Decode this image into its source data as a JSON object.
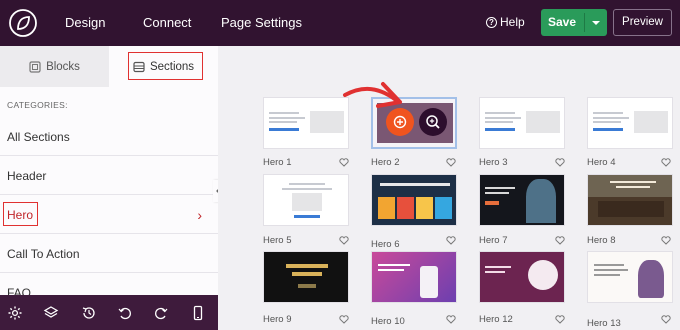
{
  "topbar": {
    "nav": [
      "Design",
      "Connect",
      "Page Settings"
    ],
    "help": "Help",
    "help_icon": "question-circle-icon",
    "save": "Save",
    "preview": "Preview"
  },
  "sidebar": {
    "tabs": {
      "blocks": "Blocks",
      "sections": "Sections",
      "active": "Sections"
    },
    "categories_title": "CATEGORIES:",
    "categories": [
      "All Sections",
      "Header",
      "Hero",
      "Call To Action",
      "FAQ"
    ],
    "active_category": "Hero"
  },
  "bottombar_icons": [
    "settings-icon",
    "layers-icon",
    "history-icon",
    "undo-icon",
    "redo-icon",
    "mobile-preview-icon"
  ],
  "thumbnails": [
    {
      "label": "Hero 1",
      "text": "My Awesome Headline"
    },
    {
      "label": "Hero 2"
    },
    {
      "label": "Hero 3",
      "text": "My Awesome Headline"
    },
    {
      "label": "Hero 4",
      "text": "My Awesome Headline"
    },
    {
      "label": "Hero 5",
      "text": "My Awesome Headline"
    },
    {
      "label": "Hero 6",
      "text": "Daily Pet Care and Store"
    },
    {
      "label": "Hero 7",
      "text": "Best Sunglasses of 2022"
    },
    {
      "label": "Hero 8",
      "text": "Buy Used Furniture for Less"
    },
    {
      "label": "Hero 9",
      "text": "Jewelry Studio"
    },
    {
      "label": "Hero 10",
      "text": "New Features Give App Solution"
    },
    {
      "label": "Hero 12",
      "text": "Hi, I'm Sarah"
    },
    {
      "label": "Hero 13",
      "text": "YOGA AND MEDITATION CENTER"
    }
  ],
  "colors": {
    "topbar": "#311330",
    "save": "#2a9b5a",
    "annotation": "#e03131",
    "add_button": "#f0541f"
  }
}
